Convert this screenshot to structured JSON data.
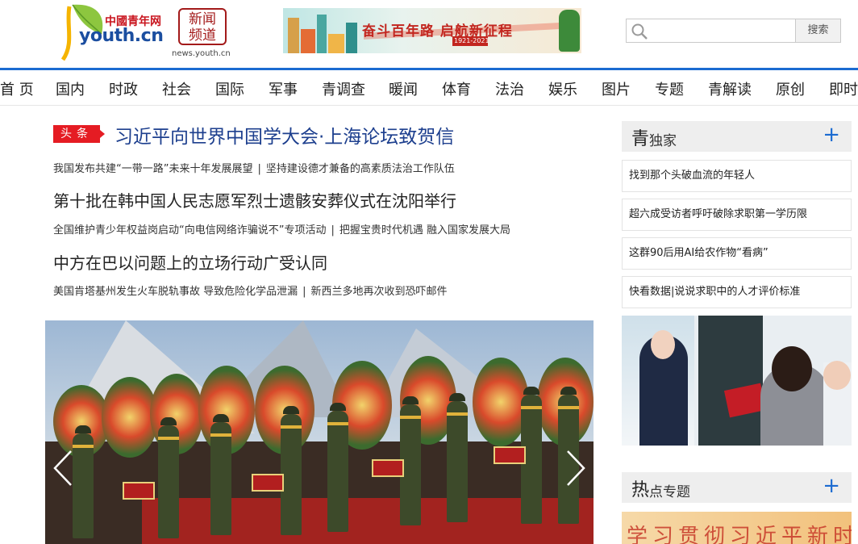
{
  "header": {
    "logo_cn": "中國青年网",
    "logo_en": "youth.cn",
    "logo_sub": "news.youth.cn",
    "channel_line1": "新闻",
    "channel_line2": "频道",
    "banner_title": "奋斗百年路 启航新征程",
    "banner_years": "1921-2021",
    "search_placeholder": "",
    "search_button": "搜索"
  },
  "nav": {
    "items": [
      "首 页",
      "国内",
      "时政",
      "社会",
      "国际",
      "军事",
      "青调查",
      "暖闻",
      "体育",
      "法治",
      "娱乐",
      "图片",
      "专题",
      "青解读",
      "原创",
      "即时"
    ]
  },
  "main": {
    "headline_tag": "头条",
    "top_headline": "习近平向世界中国学大会·上海论坛致贺信",
    "sub1": [
      "我国发布共建“一带一路”未来十年发展展望",
      "坚持建设德才兼备的高素质法治工作队伍"
    ],
    "headline2": "第十批在韩中国人民志愿军烈士遗骸安葬仪式在沈阳举行",
    "sub2": [
      "全国维护青少年权益岗启动“向电信网络诈骗说不”专项活动",
      "把握宝贵时代机遇 融入国家发展大局"
    ],
    "headline3": "中方在巴以问题上的立场行动广受认同",
    "sub3": [
      "美国肯塔基州发生火车脱轨事故 导致危险化学品泄漏",
      "新西兰多地再次收到恐吓邮件"
    ],
    "separator": "|"
  },
  "sidebar": {
    "exclusive_big": "青",
    "exclusive_small": "独家",
    "exclusive_items": [
      "找到那个头破血流的年轻人",
      "超六成受访者呼吁破除求职第一学历限",
      "这群90后用AI给农作物“看病”",
      "快看数据|说说求职中的人才评价标准"
    ],
    "topics_big": "热",
    "topics_small": "点专题",
    "plus": "+",
    "topic_banner_text": "学习贯彻习近平新时代"
  },
  "colors": {
    "accent_blue": "#1b6bd1",
    "headline_blue": "#1d3f8e",
    "tag_red": "#e51c23"
  }
}
